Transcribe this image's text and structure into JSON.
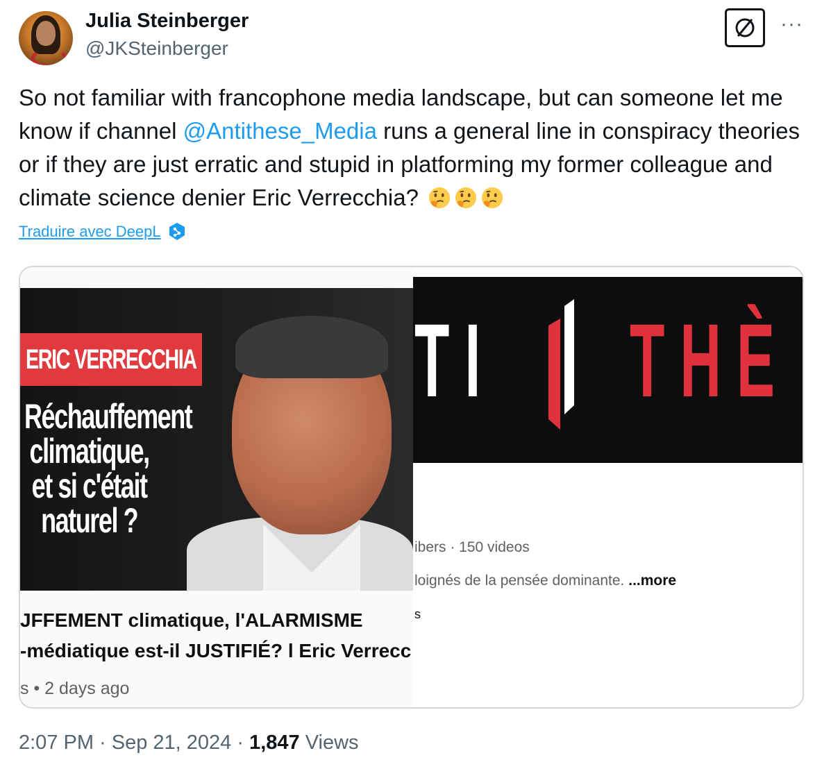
{
  "author": {
    "name": "Julia Steinberger",
    "handle": "@JKSteinberger"
  },
  "tweet": {
    "text_before": "So not familiar with francophone media landscape, but can someone let me know if channel ",
    "mention": "@Antithese_Media",
    "text_after": " runs a general line in conspiracy theories or if they are just erratic and stupid in platforming my former colleague and climate science denier Eric Verrecchia? ",
    "emojis": [
      "thinking-face",
      "thinking-face",
      "thinking-face"
    ]
  },
  "translate": {
    "label": "Traduire avec DeepL",
    "icon": "deepl-icon"
  },
  "card": {
    "video": {
      "name_tag": "ERIC VERRECCHIA",
      "overlay_lines": [
        "Réchauffement",
        "climatique,",
        "et si c'était",
        "naturel ?"
      ],
      "title_line1": "JFFEMENT climatique, l'ALARMISME",
      "title_line2": "-médiatique est-il JUSTIFIÉ? l Eric Verrecc",
      "meta": "s • 2 days ago"
    },
    "channel": {
      "banner_white": "TI",
      "banner_red": "THÈ",
      "subs": "ibers · 150 videos",
      "desc": "loignés de la pensée dominante. ",
      "more": "...more",
      "link": "s"
    }
  },
  "footer": {
    "time": "2:07 PM · Sep 21, 2024 · ",
    "views_count": "1,847",
    "views_label": " Views"
  },
  "colors": {
    "link": "#1d9bf0",
    "secondary": "#536471",
    "banner_red": "#e0323c",
    "name_tag_red": "#e03a3e"
  }
}
